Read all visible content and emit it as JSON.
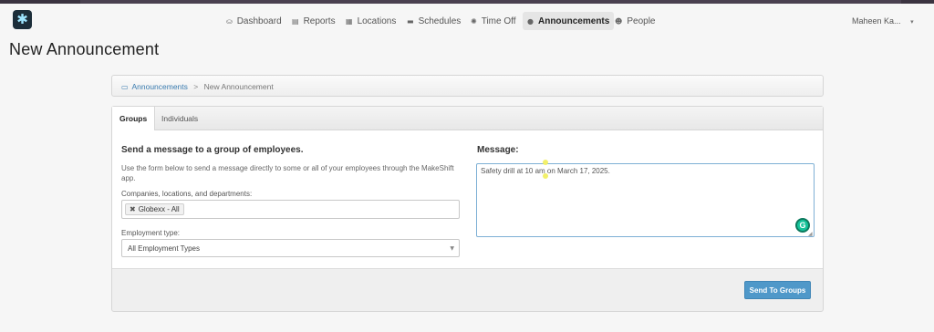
{
  "nav": {
    "items": [
      {
        "label": "Dashboard",
        "icon": "dashboard-icon",
        "glyph": "⛀"
      },
      {
        "label": "Reports",
        "icon": "reports-icon",
        "glyph": "▤"
      },
      {
        "label": "Locations",
        "icon": "locations-icon",
        "glyph": "▦"
      },
      {
        "label": "Schedules",
        "icon": "schedules-icon",
        "glyph": "▬"
      },
      {
        "label": "Time Off",
        "icon": "sun-icon",
        "glyph": "✺"
      },
      {
        "label": "Announcements",
        "icon": "chat-icon",
        "glyph": "●"
      },
      {
        "label": "People",
        "icon": "people-icon",
        "glyph": "☻"
      }
    ],
    "active_index": 5,
    "user_name": "Maheen Ka...",
    "user_caret": "▾"
  },
  "page": {
    "title": "New Announcement"
  },
  "breadcrumb": {
    "parent": "Announcements",
    "separator": ">",
    "current": "New Announcement"
  },
  "tabs": [
    "Groups",
    "Individuals"
  ],
  "form": {
    "heading": "Send a message to a group of employees.",
    "description": "Use the form below to send a message directly to some or all of your employees through the MakeShift app.",
    "companies_label": "Companies, locations, and departments:",
    "selected_tag": "Globexx - All",
    "employment_label": "Employment type:",
    "employment_value": "All Employment Types",
    "message_label": "Message:",
    "message_value": "Safety drill at 10 am on March 17, 2025.",
    "grammarly_glyph": "G",
    "send_button": "Send To Groups"
  },
  "colors": {
    "accent": "#4f98c9",
    "link": "#3a7cb0",
    "grammarly": "#15c39a"
  }
}
